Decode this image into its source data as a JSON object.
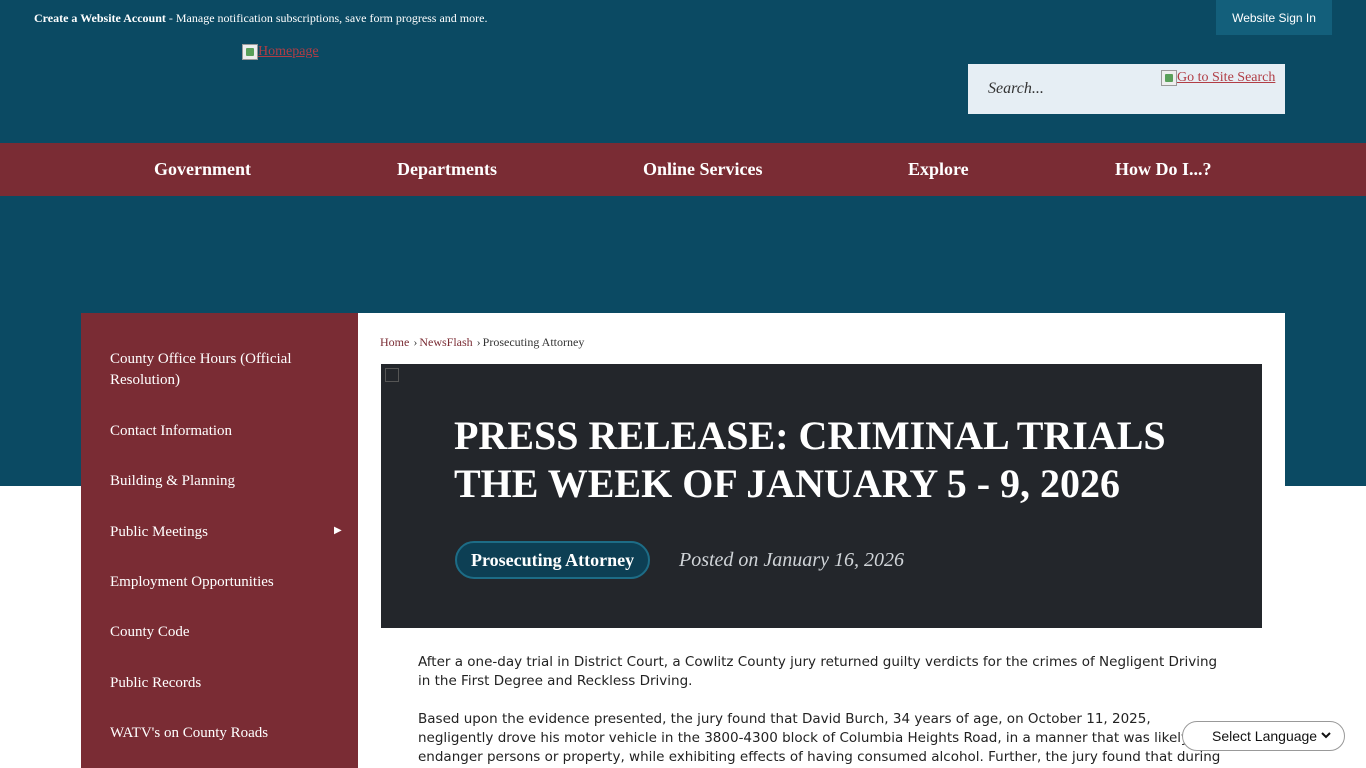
{
  "topbar": {
    "create_account": "Create a Website Account",
    "create_account_desc": " - Manage notification subscriptions, save form progress and more.",
    "sign_in": "Website Sign In"
  },
  "header": {
    "logo_alt": "Homepage",
    "search_placeholder": "Search...",
    "search_button_alt": "Go to Site Search"
  },
  "nav": {
    "items": [
      {
        "label": "Government"
      },
      {
        "label": "Departments"
      },
      {
        "label": "Online Services"
      },
      {
        "label": "Explore"
      },
      {
        "label": "How Do I...?"
      }
    ]
  },
  "sidebar": {
    "items": [
      {
        "label": "County Office Hours (Official Resolution)"
      },
      {
        "label": "Contact Information"
      },
      {
        "label": "Building & Planning"
      },
      {
        "label": "Public Meetings"
      },
      {
        "label": "Employment Opportunities"
      },
      {
        "label": "County Code"
      },
      {
        "label": "Public Records"
      },
      {
        "label": "WATV's on County Roads"
      }
    ]
  },
  "breadcrumb": {
    "home": "Home",
    "newsflash": "NewsFlash",
    "current": "Prosecuting Attorney"
  },
  "article": {
    "title": "PRESS RELEASE: CRIMINAL TRIALS THE WEEK OF JANUARY 5 - 9, 2026",
    "category": "Prosecuting Attorney",
    "posted": "Posted on January 16, 2026",
    "paragraph1": "After a one-day trial in District Court, a Cowlitz County jury returned guilty verdicts for the crimes of Negligent Driving in the First Degree and Reckless Driving.",
    "paragraph2": "Based upon the evidence presented, the jury found that David Burch, 34 years of age, on October 11, 2025, negligently drove his motor vehicle in the 3800-4300 block of Columbia Heights Road, in a manner that was likely to endanger persons or property, while exhibiting effects of having consumed alcohol.  Further, the jury found that during the incident while law"
  },
  "language": {
    "label": "Select Language"
  },
  "colors": {
    "header_teal": "#0b4a63",
    "nav_maroon": "#7a2c34",
    "hero_dark": "#23262b"
  }
}
